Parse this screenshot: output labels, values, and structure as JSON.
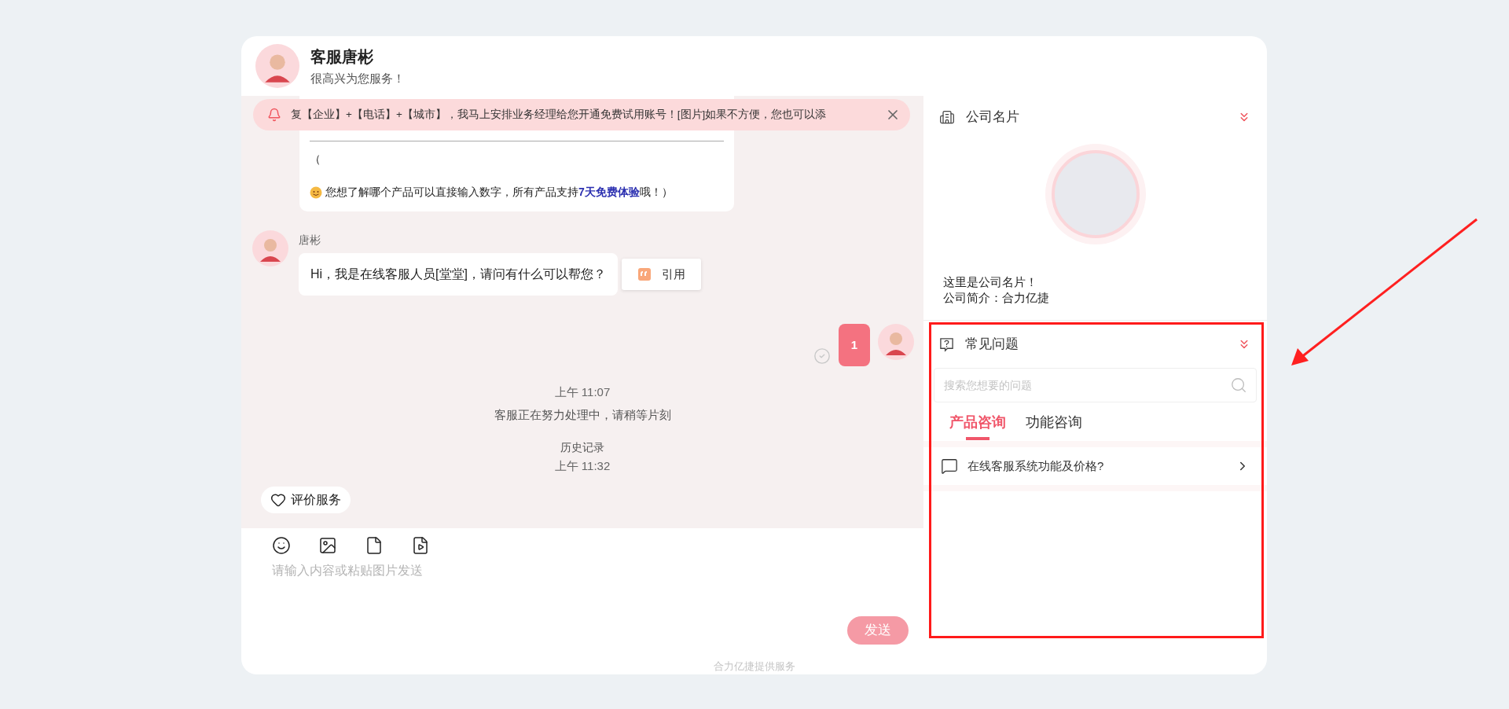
{
  "agent": {
    "name": "客服唐彬",
    "greeting": "很高兴为您服务！"
  },
  "notice": {
    "text": "复【企业】+【电话】+【城市】，我马上安排业务经理给您开通免费试用账号！[图片]如果不方便，您也可以添"
  },
  "messages": [
    {
      "kind": "bot_card",
      "lines": [
        "（"
      ],
      "text": "您想了解哪个产品可以直接输入数字，所有产品支持**7天免费体验**哦！）"
    },
    {
      "kind": "agent",
      "sender": "唐彬",
      "text": "Hi，我是在线客服人员[堂堂]，请问有什么可以帮您？",
      "quote_label": "引用"
    },
    {
      "kind": "user",
      "text": "1",
      "read": true
    },
    {
      "kind": "time",
      "text": "上午 11:07"
    },
    {
      "kind": "system",
      "text": "客服正在努力处理中，请稍等片刻"
    },
    {
      "kind": "history",
      "text": "历史记录"
    },
    {
      "kind": "time",
      "text": "上午 11:32"
    }
  ],
  "rate_button": "评价服务",
  "composer": {
    "placeholder": "请输入内容或粘贴图片发送",
    "send_label": "发送",
    "send_disabled": true
  },
  "footer": "合力亿捷提供服务",
  "company_card": {
    "title": "公司名片",
    "lines": [
      "这里是公司名片！",
      "公司简介：合力亿捷"
    ]
  },
  "faq": {
    "title": "常见问题",
    "search_placeholder": "搜索您想要的问题",
    "tabs": [
      {
        "label": "产品咨询",
        "selected": true
      },
      {
        "label": "功能咨询",
        "selected": false
      }
    ],
    "questions": [
      "在线客服系统功能及价格?"
    ]
  }
}
